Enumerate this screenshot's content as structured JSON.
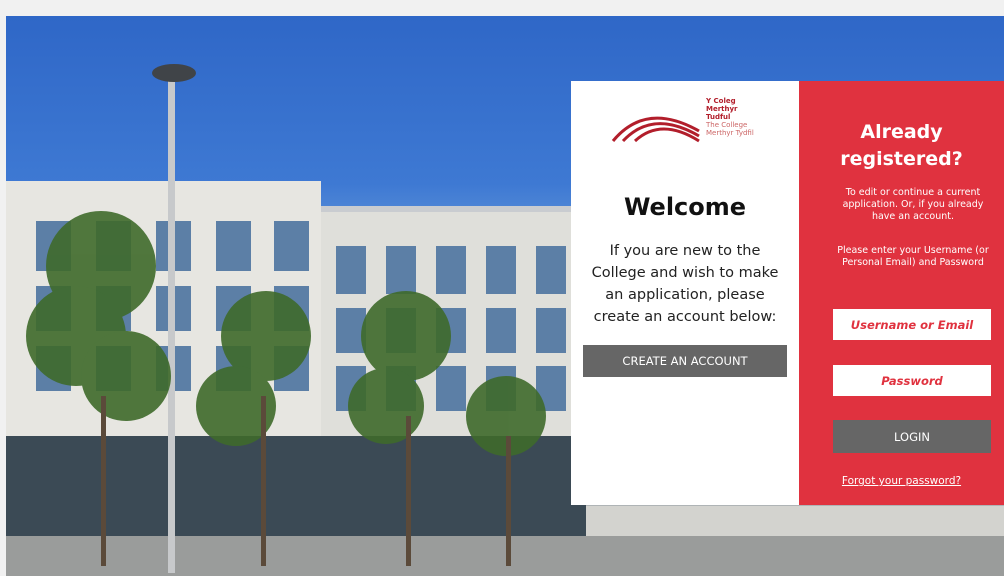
{
  "logo": {
    "line1": "Y Coleg",
    "line2": "Merthyr Tudful",
    "line3": "The College",
    "line4": "Merthyr Tydfil"
  },
  "welcome": {
    "title": "Welcome",
    "intro": "If you are new to the College and wish to make an application, please create an account below:",
    "create_button": "CREATE AN ACCOUNT"
  },
  "login": {
    "title": "Already registered?",
    "description": "To edit or continue a current application. Or, if you already have an account.",
    "instruction": "Please enter your Username (or Personal Email) and Password",
    "username_placeholder": "Username or Email",
    "password_placeholder": "Password",
    "login_button": "LOGIN",
    "forgot_link": "Forgot your password?"
  },
  "colors": {
    "accent_red": "#e0323f",
    "button_grey": "#666666"
  },
  "icons": {
    "logo_mark": "college-arcs-logo"
  }
}
